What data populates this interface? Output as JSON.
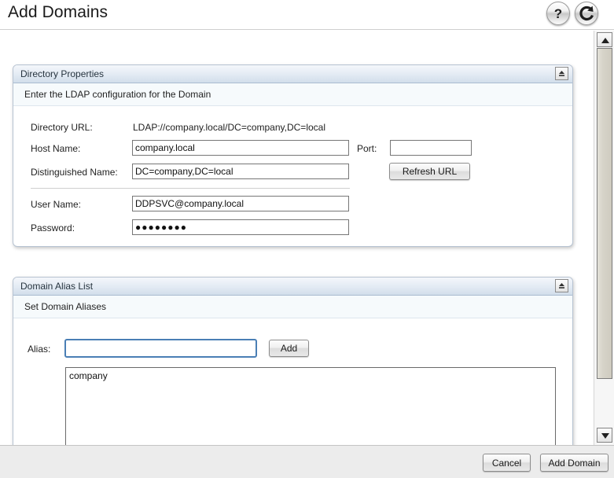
{
  "page": {
    "title": "Add Domains"
  },
  "header_tools": [
    {
      "name": "help-button",
      "icon": "question-mark-icon",
      "glyph": "?"
    },
    {
      "name": "refresh-button",
      "icon": "refresh-icon",
      "glyph": "↻"
    }
  ],
  "directory_properties": {
    "panel_title": "Directory Properties",
    "collapse_icon": "collapse-icon",
    "subheader": "Enter the LDAP configuration for the Domain",
    "fields": {
      "directory_url_label": "Directory URL:",
      "directory_url_value": "LDAP://company.local/DC=company,DC=local",
      "host_name_label": "Host Name:",
      "host_name_value": "company.local",
      "port_label": "Port:",
      "port_value": "",
      "distinguished_name_label": "Distinguished Name:",
      "distinguished_name_value": "DC=company,DC=local",
      "refresh_url_label": "Refresh URL",
      "user_name_label": "User Name:",
      "user_name_value": "DDPSVC@company.local",
      "password_label": "Password:",
      "password_value": "●●●●●●●●"
    }
  },
  "domain_alias_list": {
    "panel_title": "Domain Alias List",
    "collapse_icon": "collapse-icon",
    "subheader": "Set Domain Aliases",
    "alias_label": "Alias:",
    "alias_value": "",
    "add_label": "Add",
    "alias_items": "company"
  },
  "footer": {
    "cancel_label": "Cancel",
    "add_domain_label": "Add Domain"
  },
  "scrollbar": {
    "up_icon": "scroll-up-arrow-icon",
    "down_icon": "scroll-down-arrow-icon",
    "thumb": "scrollbar-thumb"
  }
}
